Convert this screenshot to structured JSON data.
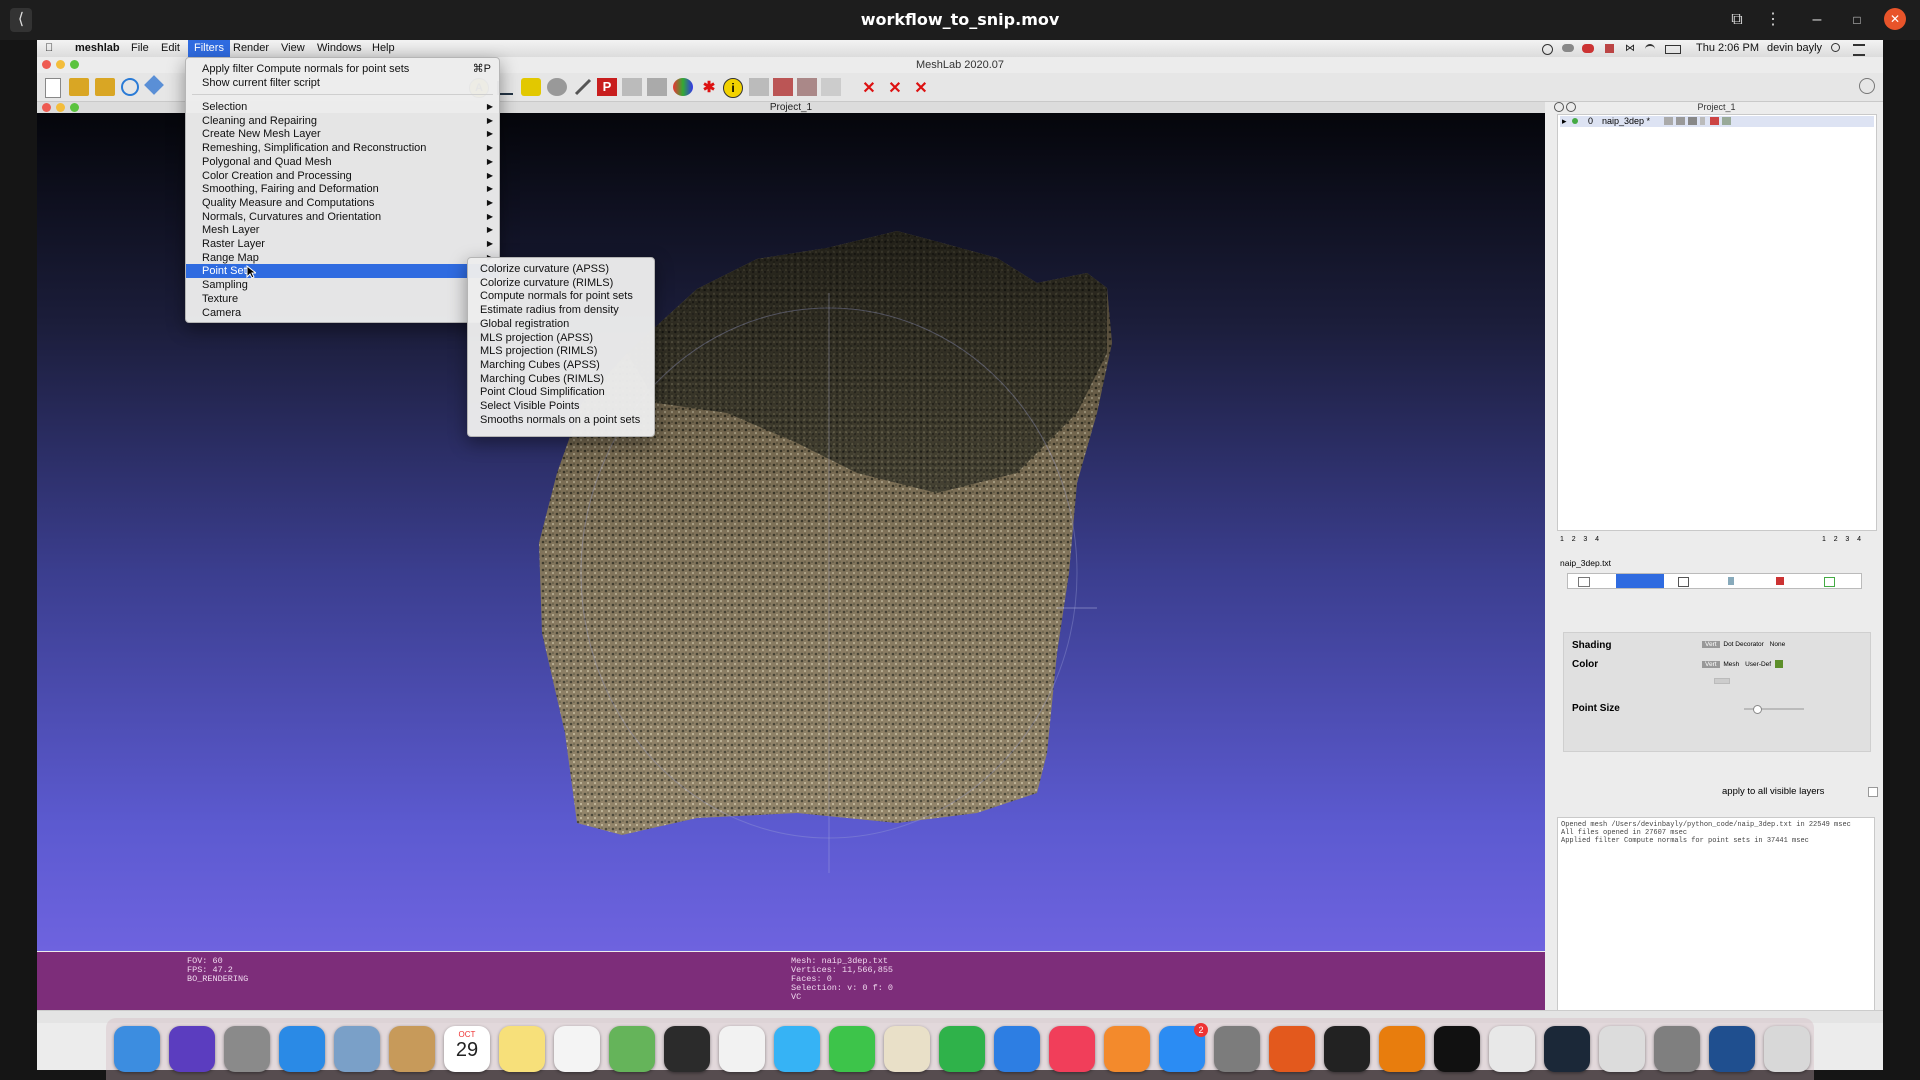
{
  "player": {
    "title": "workflow_to_snip.mov",
    "back_glyph": "⟨",
    "cast_glyph": "⧉",
    "more_glyph": "⋮",
    "min_glyph": "–",
    "max_glyph": "□",
    "close_glyph": "✕"
  },
  "menubar": {
    "apple_glyph": "",
    "app": "meshlab",
    "items": [
      "File",
      "Edit",
      "Filters",
      "Render",
      "View",
      "Windows",
      "Help"
    ],
    "clock": "Thu 2:06 PM",
    "user": "devin bayly"
  },
  "window": {
    "title": "MeshLab 2020.07",
    "subtitle": "Project_1"
  },
  "filters_menu": {
    "recent": [
      {
        "label": "Apply filter Compute normals for point sets",
        "shortcut": "⌘P"
      },
      {
        "label": "Show current filter script",
        "shortcut": ""
      }
    ],
    "items": [
      "Selection",
      "Cleaning and Repairing",
      "Create New Mesh Layer",
      "Remeshing, Simplification and Reconstruction",
      "Polygonal and Quad Mesh",
      "Color Creation and Processing",
      "Smoothing, Fairing and Deformation",
      "Quality Measure and Computations",
      "Normals, Curvatures and Orientation",
      "Mesh Layer",
      "Raster Layer",
      "Range Map",
      "Point Set",
      "Sampling",
      "Texture",
      "Camera"
    ],
    "selected": "Point Set"
  },
  "point_set_menu": {
    "items": [
      "Colorize curvature (APSS)",
      "Colorize curvature (RIMLS)",
      "Compute normals for point sets",
      "Estimate radius from density",
      "Global registration",
      "MLS projection (APSS)",
      "MLS projection (RIMLS)",
      "Marching Cubes (APSS)",
      "Marching Cubes (RIMLS)",
      "Point Cloud Simplification",
      "Select Visible Points",
      "Smooths normals on a point sets"
    ]
  },
  "viewport_info": {
    "left": [
      "FOV: 60",
      "FPS:   47.2",
      "BO_RENDERING"
    ],
    "center": [
      "Mesh: naip_3dep.txt",
      "Vertices: 11,566,855",
      "Faces: 0",
      "Selection: v: 0 f: 0",
      "VC"
    ]
  },
  "right_panel": {
    "header": "Project_1",
    "layer_index": "0",
    "layer_name": "naip_3dep *",
    "tab_numbers_left": [
      "1",
      "2",
      "3",
      "4"
    ],
    "tab_numbers_right": [
      "1",
      "2",
      "3",
      "4"
    ],
    "mesh_label": "naip_3dep.txt",
    "shading_label": "Shading",
    "shading_opts": [
      "Vert",
      "Dot Decorator",
      "None"
    ],
    "color_label": "Color",
    "color_opts": [
      "Vert",
      "Mesh",
      "User-Def"
    ],
    "point_size_label": "Point Size",
    "point_size_fraction": 0.2,
    "apply_label": "apply to all visible layers",
    "log": [
      "Opened mesh /Users/devinbayly/python_code/naip_3dep.txt in 22549 msec",
      "All files opened in 27607 msec",
      "Applied filter Compute normals for point sets in 37441 msec"
    ]
  },
  "dock": {
    "calendar_month": "OCT",
    "calendar_day": "29",
    "appstore_badge": "2"
  },
  "colors": {
    "selection": "#2f6be0",
    "infobar": "#7d2d7a",
    "user_def_swatch": "#5d8f2a"
  }
}
